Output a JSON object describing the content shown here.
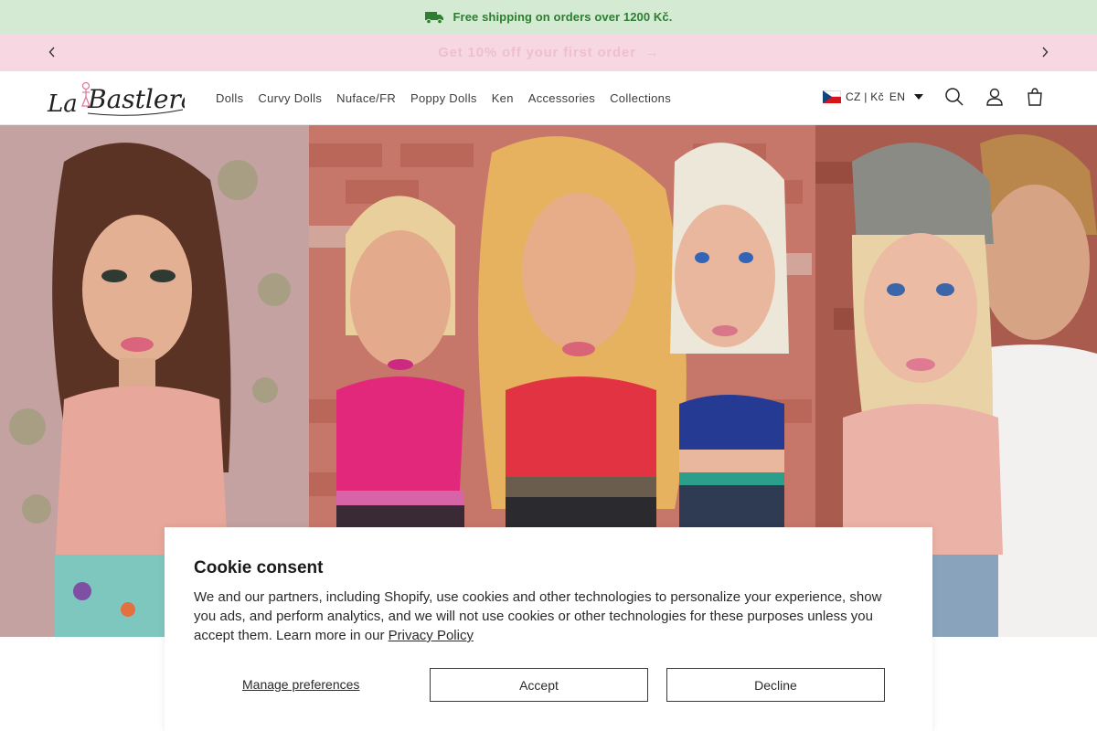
{
  "announcement": {
    "shipping_text": "Free shipping on orders over 1200 Kč.",
    "shipping_icon": "truck-icon",
    "shipping_color": "#2e7d32"
  },
  "promo": {
    "text": "Get 10% off your first order",
    "arrow": "→",
    "prev_icon": "chevron-left-icon",
    "next_icon": "chevron-right-icon",
    "background": "#f7d7e2"
  },
  "header": {
    "logo_text": "La Bastlera",
    "nav": [
      {
        "label": "Dolls"
      },
      {
        "label": "Curvy Dolls"
      },
      {
        "label": "Nuface/FR"
      },
      {
        "label": "Poppy Dolls"
      },
      {
        "label": "Ken"
      },
      {
        "label": "Accessories"
      },
      {
        "label": "Collections"
      }
    ],
    "locale": {
      "flag": "czech-flag-icon",
      "currency": "CZ | Kč",
      "language": "EN"
    },
    "icons": [
      "search-icon",
      "account-icon",
      "cart-icon"
    ]
  },
  "cookie": {
    "title": "Cookie consent",
    "body_text": "We and our partners, including Shopify, use cookies and other technologies to personalize your experience, show you ads, and perform analytics, and we will not use cookies or other technologies for these purposes unless you accept them. Learn more in our ",
    "privacy_link": "Privacy Policy",
    "manage_label": "Manage preferences",
    "accept_label": "Accept",
    "decline_label": "Decline"
  }
}
